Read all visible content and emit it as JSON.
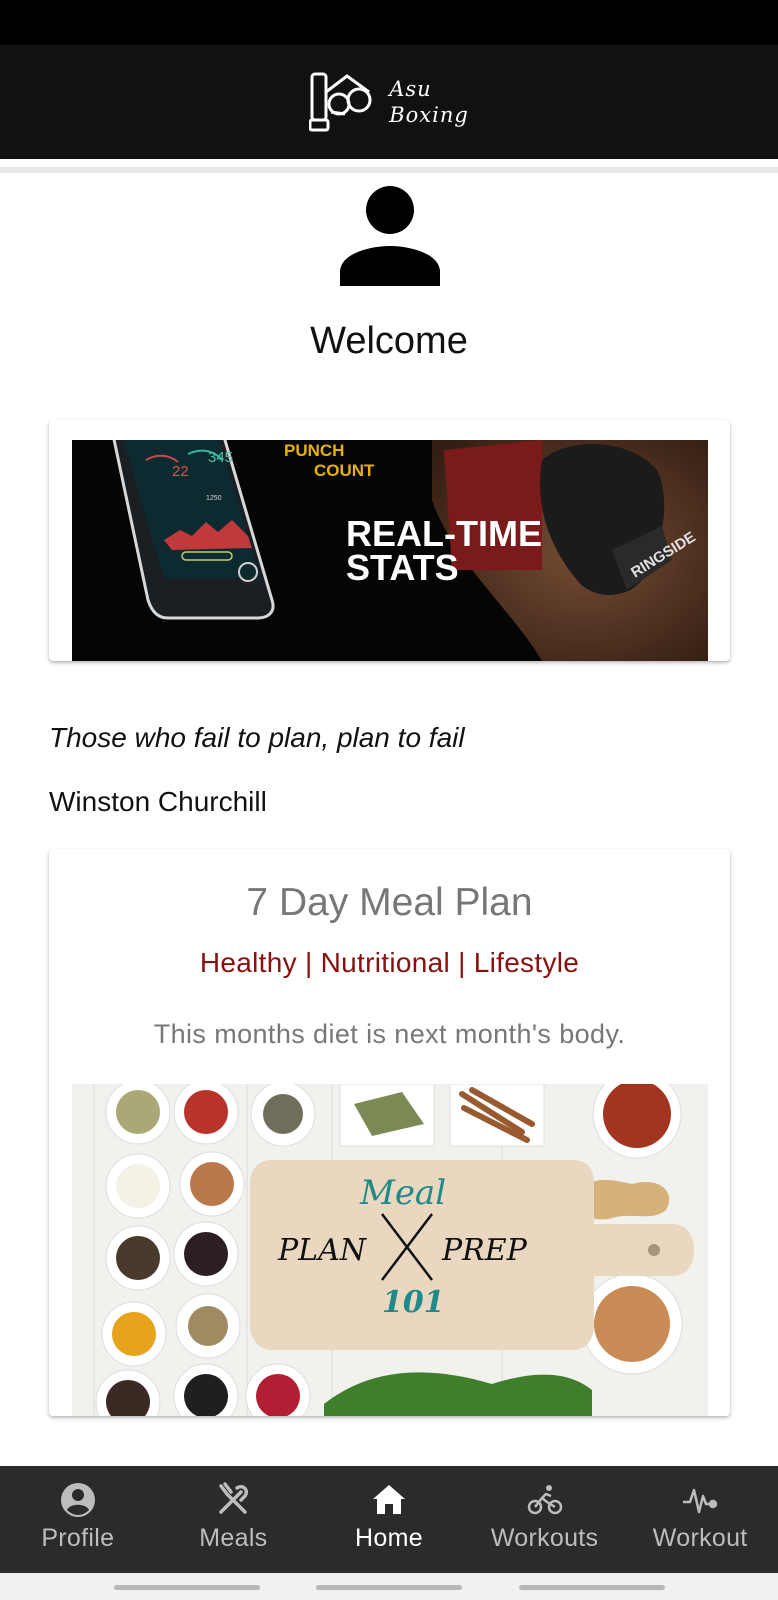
{
  "app": {
    "logo_line1": "Asu",
    "logo_line2": "Boxing"
  },
  "profile": {
    "welcome": "Welcome"
  },
  "stats_banner": {
    "punch_label": "PUNCH",
    "count_label": "COUNT",
    "headline_line1": "REAL-TIME",
    "headline_line2": "STATS",
    "phone_value_1": "22",
    "phone_value_2": "345",
    "phone_value_3": "1250",
    "glove_brand": "RINGSIDE"
  },
  "quote": {
    "text": "Those who fail to plan, plan to fail",
    "author": "Winston Churchill"
  },
  "meal_plan": {
    "title": "7 Day Meal Plan",
    "subtitle": "Healthy | Nutritional | Lifestyle",
    "tagline": "This months diet is next month's body.",
    "image_word_meal": "Meal",
    "image_word_plan": "PLAN",
    "image_word_prep": "PREP",
    "image_word_101": "101"
  },
  "bottom_nav": {
    "items": [
      {
        "label": "Profile",
        "icon": "account-circle-icon"
      },
      {
        "label": "Meals",
        "icon": "utensils-icon"
      },
      {
        "label": "Home",
        "icon": "home-icon"
      },
      {
        "label": "Workouts",
        "icon": "bike-icon"
      },
      {
        "label": "Workout",
        "icon": "pulse-icon"
      }
    ],
    "active_index": 2
  },
  "colors": {
    "header_bg": "#111111",
    "accent_red": "#8b0f0f",
    "nav_bg": "#2b2b2b"
  }
}
